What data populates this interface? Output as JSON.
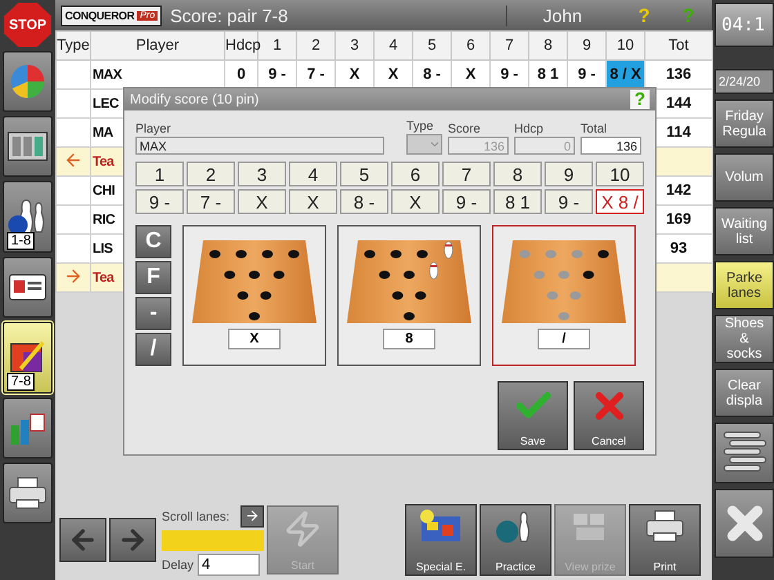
{
  "top_bar": {
    "logo": "CONQUEROR",
    "logo_badge": "Pro",
    "title": "Score: pair 7-8",
    "user": "John",
    "help": [
      {
        "glyph": "?",
        "color": "#e8c800"
      },
      {
        "glyph": "?",
        "color": "#3cb000"
      }
    ]
  },
  "stop": {
    "label": "STOP"
  },
  "left_bar": [
    {
      "kind": "pie",
      "selected": false
    },
    {
      "kind": "cabinet",
      "selected": false
    },
    {
      "kind": "bowling",
      "badge": "1-8",
      "selected": false
    },
    {
      "kind": "card",
      "selected": false
    },
    {
      "kind": "scoresheet",
      "badge": "7-8",
      "selected": true
    },
    {
      "kind": "chart",
      "selected": false
    },
    {
      "kind": "printer",
      "selected": false
    }
  ],
  "table": {
    "columns": [
      "Type",
      "Player",
      "Hdcp",
      "1",
      "2",
      "3",
      "4",
      "5",
      "6",
      "7",
      "8",
      "9",
      "10",
      "Tot"
    ],
    "rows": [
      {
        "kind": "player",
        "player": "MAX",
        "hdcp": "0",
        "frames": [
          {
            "score": "9 -",
            "selected": false
          },
          {
            "score": "7 -",
            "selected": false
          },
          {
            "score": "X",
            "selected": false
          },
          {
            "score": "X",
            "selected": false
          },
          {
            "score": "8 -",
            "selected": false
          },
          {
            "score": "X",
            "selected": false
          },
          {
            "score": "9 -",
            "selected": false
          },
          {
            "score": "8 1",
            "selected": false
          },
          {
            "score": "9 -",
            "selected": false
          },
          {
            "score": "8 / X",
            "selected": true
          }
        ],
        "total": "136"
      },
      {
        "kind": "player",
        "player": "LEC",
        "total": "144"
      },
      {
        "kind": "player",
        "player": "MA",
        "total": "114"
      },
      {
        "kind": "team",
        "player": "Tea",
        "arrow": {
          "kind": "left"
        }
      },
      {
        "kind": "player",
        "player": "CHI",
        "total": "142"
      },
      {
        "kind": "player",
        "player": "RIC",
        "total": "169"
      },
      {
        "kind": "player",
        "player": "LIS",
        "total": "93"
      },
      {
        "kind": "team",
        "player": "Tea",
        "arrow": {
          "kind": "right"
        }
      }
    ]
  },
  "dialog": {
    "title": "Modify score (10 pin)",
    "help": {
      "glyph": "?",
      "color": "#3cb000"
    },
    "player_label": "Player",
    "player": "MAX",
    "type_label": "Type",
    "score_label": "Score",
    "score": "136",
    "hdcp_label": "Hdcp",
    "hdcp": "0",
    "total_label": "Total",
    "total": "136",
    "frames": [
      {
        "number": "1",
        "score": "9 -",
        "selected": false
      },
      {
        "number": "2",
        "score": "7 -",
        "selected": false
      },
      {
        "number": "3",
        "score": "X",
        "selected": false
      },
      {
        "number": "4",
        "score": "X",
        "selected": false
      },
      {
        "number": "5",
        "score": "8 -",
        "selected": false
      },
      {
        "number": "6",
        "score": "X",
        "selected": false
      },
      {
        "number": "7",
        "score": "9 -",
        "selected": false
      },
      {
        "number": "8",
        "score": "8 1",
        "selected": false
      },
      {
        "number": "9",
        "score": "9 -",
        "selected": false
      },
      {
        "number": "10",
        "score": "X 8 /",
        "selected": true
      }
    ],
    "keys": [
      "C",
      "F",
      "-",
      "/"
    ],
    "balls": [
      {
        "result": "X",
        "selected": false,
        "pins": [
          {
            "kind": "down"
          },
          {
            "kind": "down"
          },
          {
            "kind": "down"
          },
          {
            "kind": "down"
          },
          {
            "kind": "down"
          },
          {
            "kind": "down"
          },
          {
            "kind": "down"
          },
          {
            "kind": "down"
          },
          {
            "kind": "down"
          },
          {
            "kind": "down"
          }
        ]
      },
      {
        "result": "8",
        "selected": false,
        "pins": [
          {
            "kind": "down"
          },
          {
            "kind": "down"
          },
          {
            "kind": "down"
          },
          {
            "kind": "standing"
          },
          {
            "kind": "down"
          },
          {
            "kind": "down"
          },
          {
            "kind": "standing"
          },
          {
            "kind": "down"
          },
          {
            "kind": "down"
          },
          {
            "kind": "down"
          }
        ]
      },
      {
        "result": "/",
        "selected": true,
        "pins": [
          {
            "kind": "prior"
          },
          {
            "kind": "prior"
          },
          {
            "kind": "prior"
          },
          {
            "kind": "down"
          },
          {
            "kind": "prior"
          },
          {
            "kind": "prior"
          },
          {
            "kind": "down"
          },
          {
            "kind": "prior"
          },
          {
            "kind": "prior"
          },
          {
            "kind": "prior"
          }
        ]
      }
    ],
    "buttons": [
      {
        "kind": "save",
        "label": "Save"
      },
      {
        "kind": "cancel",
        "label": "Cancel"
      }
    ]
  },
  "bottom_bar": {
    "scroll_label": "Scroll lanes:",
    "delay_label": "Delay",
    "delay": "4",
    "start": {
      "label": "Start",
      "disabled": true
    },
    "actions": [
      {
        "kind": "special",
        "label": "Special E.",
        "disabled": false
      },
      {
        "kind": "practice",
        "label": "Practice",
        "disabled": false
      },
      {
        "kind": "prize",
        "label": "View prize",
        "disabled": true
      },
      {
        "kind": "print",
        "label": "Print",
        "disabled": false
      }
    ]
  },
  "right_bar": {
    "clock": "04:1",
    "date": "2/24/20",
    "buttons": [
      {
        "kind": "text",
        "label": "Friday\nRegula",
        "selected": false
      },
      {
        "kind": "text",
        "label": "Volum",
        "selected": false
      },
      {
        "kind": "text",
        "label": "Waiting\nlist",
        "selected": false
      },
      {
        "kind": "text",
        "label": "Parke\nlanes",
        "selected": true
      },
      {
        "kind": "text",
        "label": "Shoes\n&\nsocks",
        "selected": false
      },
      {
        "kind": "text",
        "label": "Clear\ndispla",
        "selected": false
      },
      {
        "kind": "list",
        "selected": false
      },
      {
        "kind": "close",
        "selected": false
      }
    ]
  }
}
